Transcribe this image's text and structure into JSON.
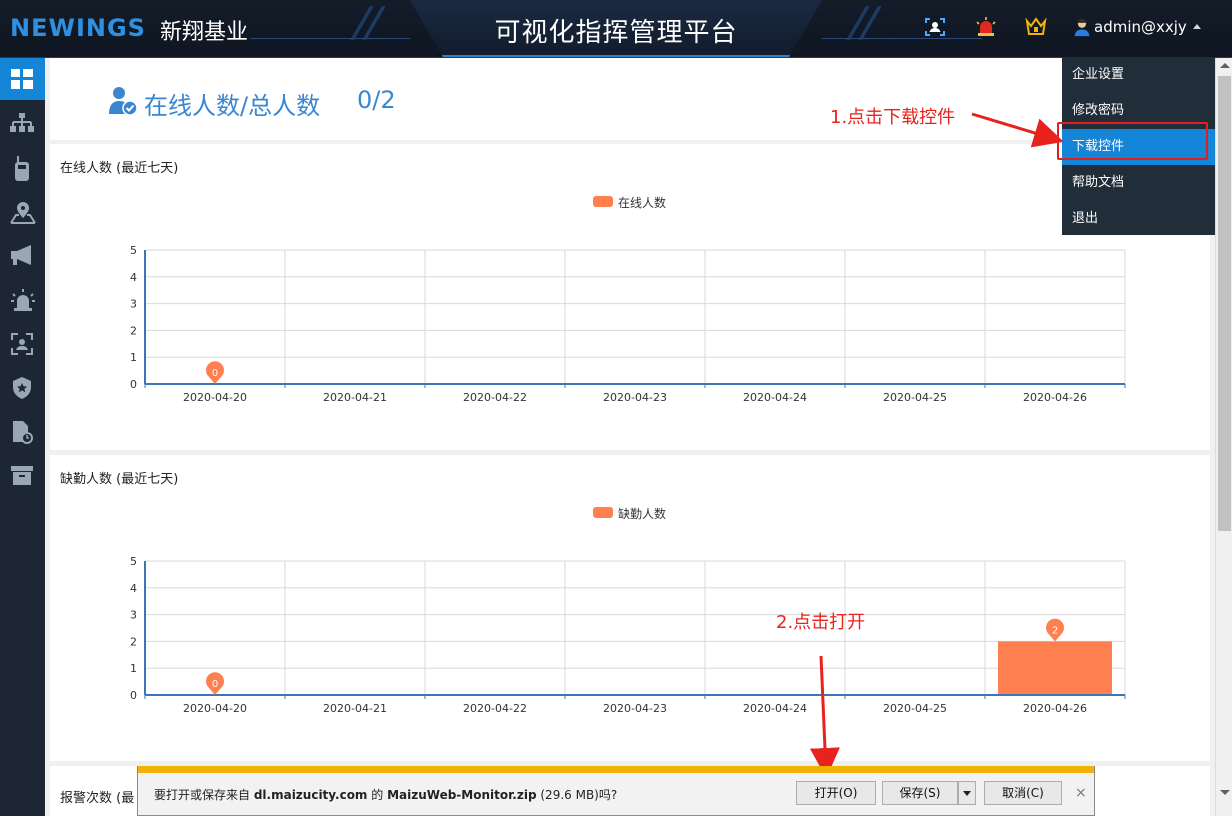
{
  "header": {
    "logo_text": "NEWINGS",
    "company_name": "新翔基业",
    "app_title": "可视化指挥管理平台",
    "user_label": "admin@xxjy",
    "icons": [
      "face-scan-icon",
      "alarm-light-icon",
      "crown-icon",
      "user-icon",
      "caret-up-icon"
    ]
  },
  "sidebar": {
    "items": [
      {
        "icon": "dashboard-icon",
        "active": true
      },
      {
        "icon": "org-tree-icon"
      },
      {
        "icon": "walkie-talkie-icon"
      },
      {
        "icon": "map-pin-icon"
      },
      {
        "icon": "megaphone-icon"
      },
      {
        "icon": "alarm-light-icon"
      },
      {
        "icon": "face-scan-icon"
      },
      {
        "icon": "shield-star-icon"
      },
      {
        "icon": "file-clock-icon"
      },
      {
        "icon": "archive-box-icon"
      }
    ]
  },
  "summary": {
    "label": "在线人数/总人数",
    "value": "0/2"
  },
  "charts": [
    {
      "title": "在线人数 (最近七天)",
      "legend": "在线人数"
    },
    {
      "title": "缺勤人数 (最近七天)",
      "legend": "缺勤人数"
    },
    {
      "title": "报警次数 (最"
    }
  ],
  "chart_data": [
    {
      "type": "bar",
      "categories": [
        "2020-04-20",
        "2020-04-21",
        "2020-04-22",
        "2020-04-23",
        "2020-04-24",
        "2020-04-25",
        "2020-04-26"
      ],
      "series": [
        {
          "name": "在线人数",
          "values": [
            0,
            0,
            0,
            0,
            0,
            0,
            0
          ]
        }
      ],
      "markers": [
        {
          "category": "2020-04-20",
          "label": "0"
        }
      ],
      "ylim": [
        0,
        5
      ],
      "yticks": [
        0,
        1,
        2,
        3,
        4,
        5
      ],
      "grid": true,
      "legend_position": "top-center",
      "color": "#ff7f50"
    },
    {
      "type": "bar",
      "categories": [
        "2020-04-20",
        "2020-04-21",
        "2020-04-22",
        "2020-04-23",
        "2020-04-24",
        "2020-04-25",
        "2020-04-26"
      ],
      "series": [
        {
          "name": "缺勤人数",
          "values": [
            0,
            0,
            0,
            0,
            0,
            0,
            2
          ]
        }
      ],
      "markers": [
        {
          "category": "2020-04-20",
          "label": "0"
        },
        {
          "category": "2020-04-26",
          "label": "2"
        }
      ],
      "ylim": [
        0,
        5
      ],
      "yticks": [
        0,
        1,
        2,
        3,
        4,
        5
      ],
      "grid": true,
      "legend_position": "top-center",
      "color": "#ff7f50"
    }
  ],
  "dropdown": {
    "items": [
      "企业设置",
      "修改密码",
      "下载控件",
      "帮助文档",
      "退出"
    ],
    "active_index": 2
  },
  "annotations": {
    "step1": "1.点击下载控件",
    "step2": "2.点击打开"
  },
  "download_bar": {
    "prompt_prefix": "要打开或保存来自 ",
    "domain": "dl.maizucity.com",
    "prompt_mid": " 的 ",
    "filename": "MaizuWeb-Monitor.zip",
    "prompt_suffix": " (29.6 MB)吗?",
    "open_label": "打开(O)",
    "save_label": "保存(S)",
    "cancel_label": "取消(C)",
    "close_label": "×"
  },
  "colors": {
    "accent": "#1585d8",
    "topbar": "#141c29",
    "sidebar": "#1d2733",
    "series": "#ff7f50",
    "annotation": "#e8221c",
    "download_bar_accent": "#f0b400"
  }
}
